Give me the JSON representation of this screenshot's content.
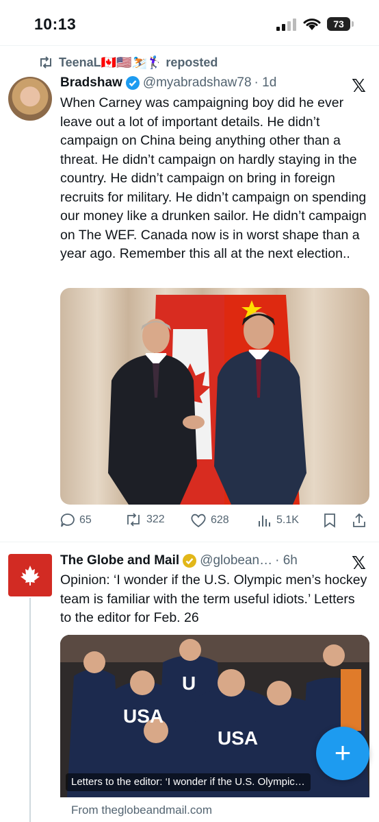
{
  "status_bar": {
    "time": "10:13",
    "battery": "73"
  },
  "post1": {
    "repost_label": "TeenaL🇨🇦🇺🇸⛷️🏌️‍♀️ reposted",
    "author_name": "Bradshaw",
    "author_handle": "@myabradshaw78",
    "timestamp": "· 1d",
    "text": "When Carney was campaigning boy did he ever leave out a lot of important details. He didn’t campaign on China being anything other than a threat. He didn’t campaign on hardly staying in the country. He didn’t campaign on bring in foreign recruits for military. He didn’t campaign on spending our money like a drunken sailor. He didn’t campaign on The WEF. Canada now is in worst shape than a year ago. Remember this all at the next election..",
    "replies": "65",
    "reposts": "322",
    "likes": "628",
    "views": "5.1K"
  },
  "post2": {
    "author_name": "The Globe and Mail",
    "author_handle": "@globean…",
    "timestamp": "· 6h",
    "text": "Opinion: ‘I wonder if the U.S. Olympic men’s hockey team is familiar with the term useful idiots.’ Letters to the editor for Feb. 26",
    "link_caption": "Letters to the editor: ‘I wonder if the U.S. Olympic…",
    "link_source": "From theglobeandmail.com"
  },
  "colors": {
    "accent": "#1d9bf0",
    "verified_blue": "#1d9bf0",
    "verified_gold": "#e2b719",
    "brand_red": "#d22b23"
  },
  "icons": [
    "repost-icon",
    "verified-badge-icon",
    "x-logo-icon",
    "reply-icon",
    "like-icon",
    "views-icon",
    "bookmark-icon",
    "share-icon",
    "maple-leaf-icon",
    "plus-icon"
  ]
}
